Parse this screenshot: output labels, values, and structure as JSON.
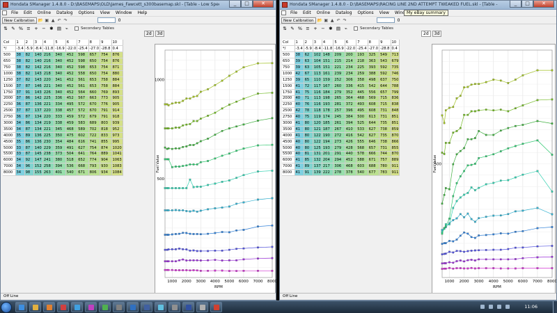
{
  "windows": [
    {
      "title": "Hondata SManager 1.4.8.0 - D:\\BASEMAPS\\OLD\\James_Fawcett_s300basemap.skl - [Table - Low Speed Fuel]",
      "menu": [
        "File",
        "Edit",
        "Online",
        "Datalog",
        "Options",
        "View",
        "Window",
        "Help"
      ],
      "toolbar": {
        "new_calibration": "New Calibration",
        "value": "0"
      },
      "secondary_tables": "Secondary Tables",
      "tabs": [
        "2d",
        "3d"
      ],
      "status": "Off Line",
      "table": {
        "header_cols": [
          "Col",
          "1",
          "2",
          "3",
          "4",
          "5",
          "6",
          "7",
          "8",
          "9",
          "10"
        ],
        "header_vals": [
          "*/",
          "-3.4",
          "-5.9",
          "-8.4",
          "-11.8",
          "-16.9",
          "-22.0",
          "-25.4",
          "-27.0",
          "-28.8",
          "0.4"
        ],
        "rows": [
          [
            "500",
            "38",
            "82",
            "140",
            "216",
            "340",
            "452",
            "598",
            "657",
            "754",
            "876"
          ],
          [
            "650",
            "38",
            "82",
            "140",
            "216",
            "340",
            "452",
            "598",
            "650",
            "754",
            "876"
          ],
          [
            "750",
            "38",
            "82",
            "142",
            "216",
            "340",
            "452",
            "598",
            "653",
            "754",
            "871"
          ],
          [
            "1000",
            "38",
            "82",
            "143",
            "218",
            "340",
            "452",
            "558",
            "650",
            "754",
            "880"
          ],
          [
            "1250",
            "37",
            "82",
            "143",
            "220",
            "341",
            "452",
            "561",
            "653",
            "758",
            "884"
          ],
          [
            "1500",
            "37",
            "87",
            "146",
            "221",
            "340",
            "452",
            "561",
            "653",
            "758",
            "884"
          ],
          [
            "1750",
            "37",
            "91",
            "143",
            "226",
            "340",
            "452",
            "564",
            "660",
            "769",
            "893"
          ],
          [
            "2000",
            "37",
            "86",
            "142",
            "225",
            "336",
            "452",
            "567",
            "663",
            "773",
            "905"
          ],
          [
            "2250",
            "36",
            "87",
            "136",
            "221",
            "334",
            "495",
            "572",
            "670",
            "776",
            "905"
          ],
          [
            "2500",
            "37",
            "87",
            "137",
            "220",
            "338",
            "457",
            "572",
            "670",
            "791",
            "914"
          ],
          [
            "2750",
            "36",
            "87",
            "134",
            "220",
            "333",
            "459",
            "572",
            "679",
            "791",
            "918"
          ],
          [
            "3000",
            "34",
            "86",
            "134",
            "219",
            "338",
            "459",
            "583",
            "689",
            "803",
            "939"
          ],
          [
            "3500",
            "34",
            "87",
            "134",
            "221",
            "345",
            "468",
            "589",
            "702",
            "818",
            "952"
          ],
          [
            "4000",
            "35",
            "89",
            "136",
            "225",
            "350",
            "475",
            "602",
            "722",
            "833",
            "973"
          ],
          [
            "4500",
            "35",
            "86",
            "136",
            "230",
            "354",
            "484",
            "616",
            "741",
            "855",
            "995"
          ],
          [
            "5000",
            "33",
            "87",
            "140",
            "229",
            "359",
            "491",
            "627",
            "754",
            "874",
            "1020"
          ],
          [
            "5500",
            "33",
            "87",
            "145",
            "238",
            "373",
            "504",
            "641",
            "764",
            "889",
            "1041"
          ],
          [
            "6000",
            "34",
            "92",
            "147",
            "241",
            "380",
            "518",
            "652",
            "774",
            "904",
            "1063"
          ],
          [
            "7000",
            "34",
            "96",
            "152",
            "258",
            "394",
            "536",
            "668",
            "793",
            "930",
            "1083"
          ],
          [
            "8000",
            "34",
            "98",
            "155",
            "263",
            "401",
            "540",
            "671",
            "806",
            "934",
            "1084"
          ]
        ]
      },
      "chart_data": {
        "type": "line",
        "xlabel": "RPM",
        "ylabel": "Fuel Value",
        "x": [
          500,
          650,
          750,
          1000,
          1250,
          1500,
          1750,
          2000,
          2250,
          2500,
          2750,
          3000,
          3500,
          4000,
          4500,
          5000,
          5500,
          6000,
          7000,
          8000
        ],
        "xlim": [
          500,
          8000
        ],
        "ylim": [
          0,
          1150
        ],
        "xticks": [
          "1000",
          "2000",
          "3000",
          "4000",
          "5000",
          "6000",
          "7000",
          "8000"
        ],
        "yticks": [
          "500",
          "1000"
        ]
      }
    },
    {
      "title": "Hondata SManager 1.4.8.0 - D:\\BASEMAPS\\RACING LINE 2ND ATTEMPT TWEAKED FUEL.skl - [Table - Low Speed Fuel]",
      "menu": [
        "File",
        "Edit",
        "Online",
        "Datalog",
        "Options",
        "View",
        "Window"
      ],
      "tooltip": "My eBay summary",
      "toolbar": {
        "new_calibration": "New Calibration",
        "value": "0"
      },
      "secondary_tables": "Secondary Tables",
      "tabs": [
        "2d",
        "3d"
      ],
      "status": "Off Line",
      "table": {
        "header_cols": [
          "Col",
          "1",
          "2",
          "3",
          "4",
          "5",
          "6",
          "7",
          "8",
          "9",
          "10"
        ],
        "header_vals": [
          "*/",
          "-3.4",
          "-5.9",
          "-8.4",
          "-11.8",
          "-16.9",
          "-22.0",
          "-25.4",
          "-27.0",
          "-28.8",
          "0.4"
        ],
        "rows": [
          [
            "500",
            "38",
            "62",
            "102",
            "148",
            "209",
            "200",
            "193",
            "325",
            "549",
            "713"
          ],
          [
            "650",
            "39",
            "63",
            "104",
            "151",
            "215",
            "214",
            "218",
            "363",
            "543",
            "679"
          ],
          [
            "750",
            "39",
            "63",
            "105",
            "151",
            "221",
            "234",
            "225",
            "393",
            "592",
            "735"
          ],
          [
            "1000",
            "42",
            "67",
            "113",
            "161",
            "239",
            "234",
            "259",
            "388",
            "592",
            "746"
          ],
          [
            "1250",
            "39",
            "65",
            "110",
            "159",
            "252",
            "306",
            "358",
            "498",
            "637",
            "750"
          ],
          [
            "1500",
            "41",
            "72",
            "117",
            "167",
            "260",
            "336",
            "415",
            "542",
            "644",
            "788"
          ],
          [
            "1750",
            "41",
            "75",
            "116",
            "184",
            "279",
            "352",
            "445",
            "556",
            "657",
            "799"
          ],
          [
            "2000",
            "40",
            "71",
            "113",
            "198",
            "265",
            "364",
            "468",
            "569",
            "715",
            "836"
          ],
          [
            "2250",
            "40",
            "76",
            "116",
            "193",
            "281",
            "372",
            "493",
            "608",
            "715",
            "838"
          ],
          [
            "2500",
            "42",
            "78",
            "118",
            "178",
            "257",
            "396",
            "495",
            "608",
            "731",
            "848"
          ],
          [
            "2750",
            "40",
            "75",
            "119",
            "174",
            "245",
            "384",
            "500",
            "613",
            "731",
            "851"
          ],
          [
            "3000",
            "41",
            "80",
            "120",
            "185",
            "261",
            "394",
            "525",
            "644",
            "735",
            "851"
          ],
          [
            "3500",
            "41",
            "80",
            "121",
            "187",
            "267",
            "410",
            "533",
            "627",
            "738",
            "859"
          ],
          [
            "4000",
            "41",
            "80",
            "122",
            "190",
            "272",
            "416",
            "542",
            "627",
            "735",
            "870"
          ],
          [
            "4500",
            "40",
            "80",
            "122",
            "194",
            "273",
            "426",
            "555",
            "646",
            "738",
            "866"
          ],
          [
            "5000",
            "40",
            "80",
            "125",
            "193",
            "279",
            "428",
            "568",
            "657",
            "731",
            "855"
          ],
          [
            "5500",
            "40",
            "81",
            "131",
            "201",
            "291",
            "440",
            "578",
            "666",
            "744",
            "870"
          ],
          [
            "6000",
            "41",
            "85",
            "132",
            "204",
            "294",
            "452",
            "588",
            "671",
            "757",
            "889"
          ],
          [
            "7000",
            "41",
            "89",
            "137",
            "217",
            "306",
            "468",
            "603",
            "688",
            "780",
            "911"
          ],
          [
            "8000",
            "41",
            "91",
            "139",
            "222",
            "278",
            "378",
            "540",
            "677",
            "783",
            "911"
          ]
        ]
      },
      "chart_data": {
        "type": "line",
        "xlabel": "RPM",
        "ylabel": "Fuel Value",
        "x": [
          500,
          650,
          750,
          1000,
          1250,
          1500,
          1750,
          2000,
          2250,
          2500,
          2750,
          3000,
          3500,
          4000,
          4500,
          5000,
          5500,
          6000,
          7000,
          8000
        ],
        "xlim": [
          500,
          8000
        ],
        "ylim": [
          0,
          1000
        ],
        "xticks": [
          "1000",
          "2000",
          "3000",
          "4000",
          "5000",
          "6000",
          "7000",
          "8000"
        ],
        "yticks": [
          "500"
        ]
      }
    }
  ],
  "taskbar": {
    "clock": "11:06"
  },
  "series_colors": [
    "#d030d0",
    "#9a30d8",
    "#5050e0",
    "#3080d8",
    "#30b0d0",
    "#30d0b0",
    "#30c870",
    "#40b040",
    "#70b820",
    "#a0c020"
  ]
}
